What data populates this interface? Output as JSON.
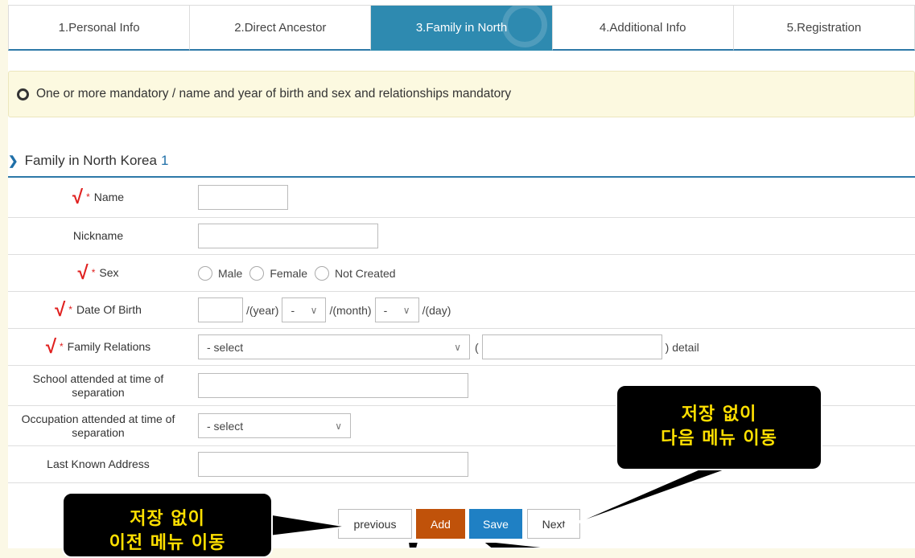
{
  "steps": [
    {
      "label": "1.Personal Info"
    },
    {
      "label": "2.Direct Ancestor"
    },
    {
      "label": "3.Family in North"
    },
    {
      "label": "4.Additional Info"
    },
    {
      "label": "5.Registration"
    }
  ],
  "active_step": 2,
  "notice": "One or more mandatory / name and year of birth and sex and relationships mandatory",
  "section": {
    "title": "Family in North Korea",
    "number": "1"
  },
  "form": {
    "check_mark": "√",
    "star": "*",
    "name_label": "Name",
    "nickname_label": "Nickname",
    "sex_label": "Sex",
    "sex_options": [
      "Male",
      "Female",
      "Not Created"
    ],
    "dob_label": "Date Of Birth",
    "year_text": "/(year)",
    "month_value": "-",
    "month_text": "/(month)",
    "day_value": "-",
    "day_text": "/(day)",
    "relations_label": "Family Relations",
    "relations_value": "- select",
    "paren_open": "(",
    "detail_text": ") detail",
    "school_label": "School attended at time of separation",
    "occupation_label": "Occupation attended at time of separation",
    "occupation_value": "- select",
    "address_label": "Last Known Address"
  },
  "buttons": {
    "previous": "previous",
    "add": "Add",
    "save": "Save",
    "next": "Next"
  },
  "callouts": {
    "next_line1": "저장 없이",
    "next_line2": "다음 메뉴 이동",
    "prev_line1": "저장 없이",
    "prev_line2": "이전 메뉴 이동"
  },
  "colors": {
    "accent": "#2e8ab0",
    "add": "#c0520a",
    "save": "#1f80c4",
    "required": "#e0201f",
    "callout_text": "#ffe000"
  }
}
